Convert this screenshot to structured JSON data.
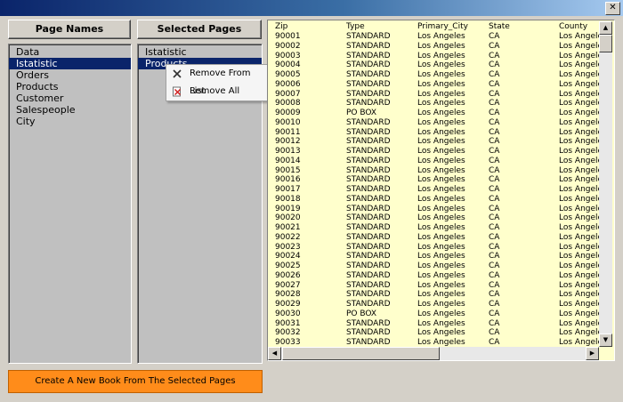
{
  "window": {
    "close_glyph": "✕"
  },
  "headers": {
    "page_names": "Page Names",
    "selected_pages": "Selected Pages"
  },
  "page_names": [
    "Data",
    "Istatistic",
    "Orders",
    "Products",
    "Customer",
    "Salespeople",
    "City"
  ],
  "page_names_selected": "Istatistic",
  "selected_pages": [
    "Istatistic",
    "Products"
  ],
  "selected_pages_selected": "Products",
  "context_menu": [
    {
      "label": "Remove From List",
      "icon": "remove-x-icon"
    },
    {
      "label": "Remove All",
      "icon": "remove-all-icon"
    }
  ],
  "grid": {
    "columns": [
      "Zip",
      "Type",
      "Primary_City",
      "State",
      "County"
    ],
    "rows": [
      [
        "90001",
        "STANDARD",
        "Los Angeles",
        "CA",
        "Los Angeles"
      ],
      [
        "90002",
        "STANDARD",
        "Los Angeles",
        "CA",
        "Los Angeles"
      ],
      [
        "90003",
        "STANDARD",
        "Los Angeles",
        "CA",
        "Los Angeles"
      ],
      [
        "90004",
        "STANDARD",
        "Los Angeles",
        "CA",
        "Los Angeles"
      ],
      [
        "90005",
        "STANDARD",
        "Los Angeles",
        "CA",
        "Los Angeles"
      ],
      [
        "90006",
        "STANDARD",
        "Los Angeles",
        "CA",
        "Los Angeles"
      ],
      [
        "90007",
        "STANDARD",
        "Los Angeles",
        "CA",
        "Los Angeles"
      ],
      [
        "90008",
        "STANDARD",
        "Los Angeles",
        "CA",
        "Los Angeles"
      ],
      [
        "90009",
        "PO BOX",
        "Los Angeles",
        "CA",
        "Los Angeles"
      ],
      [
        "90010",
        "STANDARD",
        "Los Angeles",
        "CA",
        "Los Angeles"
      ],
      [
        "90011",
        "STANDARD",
        "Los Angeles",
        "CA",
        "Los Angeles"
      ],
      [
        "90012",
        "STANDARD",
        "Los Angeles",
        "CA",
        "Los Angeles"
      ],
      [
        "90013",
        "STANDARD",
        "Los Angeles",
        "CA",
        "Los Angeles"
      ],
      [
        "90014",
        "STANDARD",
        "Los Angeles",
        "CA",
        "Los Angeles"
      ],
      [
        "90015",
        "STANDARD",
        "Los Angeles",
        "CA",
        "Los Angeles"
      ],
      [
        "90016",
        "STANDARD",
        "Los Angeles",
        "CA",
        "Los Angeles"
      ],
      [
        "90017",
        "STANDARD",
        "Los Angeles",
        "CA",
        "Los Angeles"
      ],
      [
        "90018",
        "STANDARD",
        "Los Angeles",
        "CA",
        "Los Angeles"
      ],
      [
        "90019",
        "STANDARD",
        "Los Angeles",
        "CA",
        "Los Angeles"
      ],
      [
        "90020",
        "STANDARD",
        "Los Angeles",
        "CA",
        "Los Angeles"
      ],
      [
        "90021",
        "STANDARD",
        "Los Angeles",
        "CA",
        "Los Angeles"
      ],
      [
        "90022",
        "STANDARD",
        "Los Angeles",
        "CA",
        "Los Angeles"
      ],
      [
        "90023",
        "STANDARD",
        "Los Angeles",
        "CA",
        "Los Angeles"
      ],
      [
        "90024",
        "STANDARD",
        "Los Angeles",
        "CA",
        "Los Angeles"
      ],
      [
        "90025",
        "STANDARD",
        "Los Angeles",
        "CA",
        "Los Angeles"
      ],
      [
        "90026",
        "STANDARD",
        "Los Angeles",
        "CA",
        "Los Angeles"
      ],
      [
        "90027",
        "STANDARD",
        "Los Angeles",
        "CA",
        "Los Angeles"
      ],
      [
        "90028",
        "STANDARD",
        "Los Angeles",
        "CA",
        "Los Angeles"
      ],
      [
        "90029",
        "STANDARD",
        "Los Angeles",
        "CA",
        "Los Angeles"
      ],
      [
        "90030",
        "PO BOX",
        "Los Angeles",
        "CA",
        "Los Angeles"
      ],
      [
        "90031",
        "STANDARD",
        "Los Angeles",
        "CA",
        "Los Angeles"
      ],
      [
        "90032",
        "STANDARD",
        "Los Angeles",
        "CA",
        "Los Angeles"
      ],
      [
        "90033",
        "STANDARD",
        "Los Angeles",
        "CA",
        "Los Angeles"
      ]
    ]
  },
  "create_button": "Create A New Book From The Selected Pages",
  "colors": {
    "selection": "#0a246a",
    "grid_bg": "#ffffcc",
    "create_button": "#ff8c1a"
  }
}
